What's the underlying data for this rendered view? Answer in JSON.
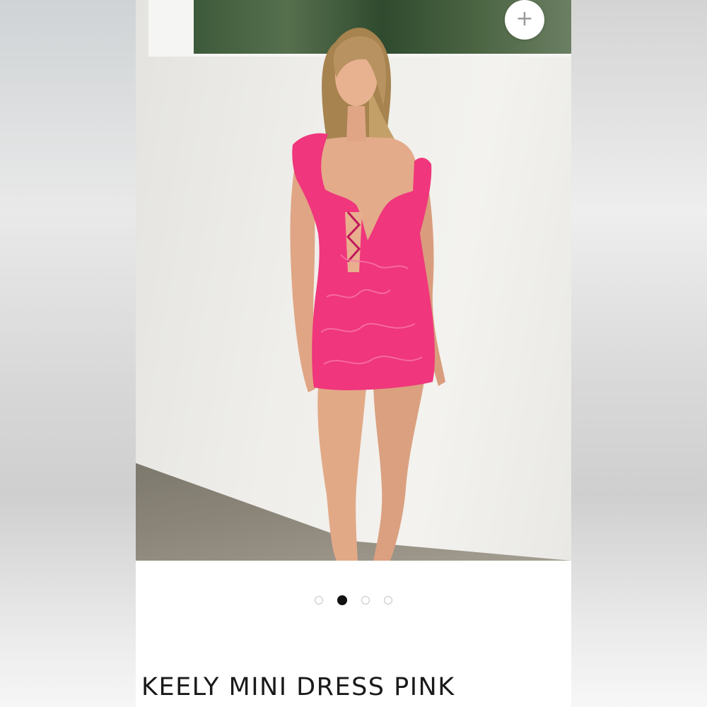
{
  "gallery": {
    "add_icon": "plus-icon",
    "slide_count": 4,
    "active_slide": 2,
    "dots": [
      {
        "active": false
      },
      {
        "active": true
      },
      {
        "active": false
      },
      {
        "active": false
      }
    ]
  },
  "product": {
    "title": "KEELY MINI DRESS PINK"
  },
  "colors": {
    "dress": "#f0367c",
    "wall": "#efeeea",
    "dot_active": "#111111",
    "dot_inactive": "#c4c4c4"
  }
}
